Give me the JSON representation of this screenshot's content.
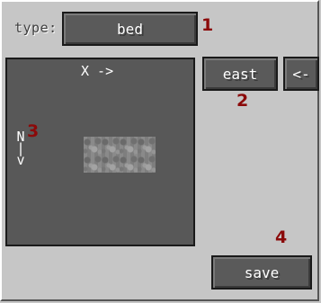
{
  "type_field": {
    "label": "type:",
    "value": "bed"
  },
  "direction_button": {
    "label": "east"
  },
  "back_button": {
    "label": "<-"
  },
  "save_button": {
    "label": "save"
  },
  "preview": {
    "x_axis_label": "X ->",
    "y_axis_letter": "N",
    "y_axis_arrow_line1": "|",
    "y_axis_arrow_line2": "v",
    "block_icon": "stone-block-icon"
  },
  "annotations": [
    "1",
    "2",
    "3",
    "4"
  ],
  "colors": {
    "background": "#c6c6c6",
    "button_face": "#5a5a5a",
    "preview_bg": "#585858",
    "annotation": "#8b0a0a"
  }
}
